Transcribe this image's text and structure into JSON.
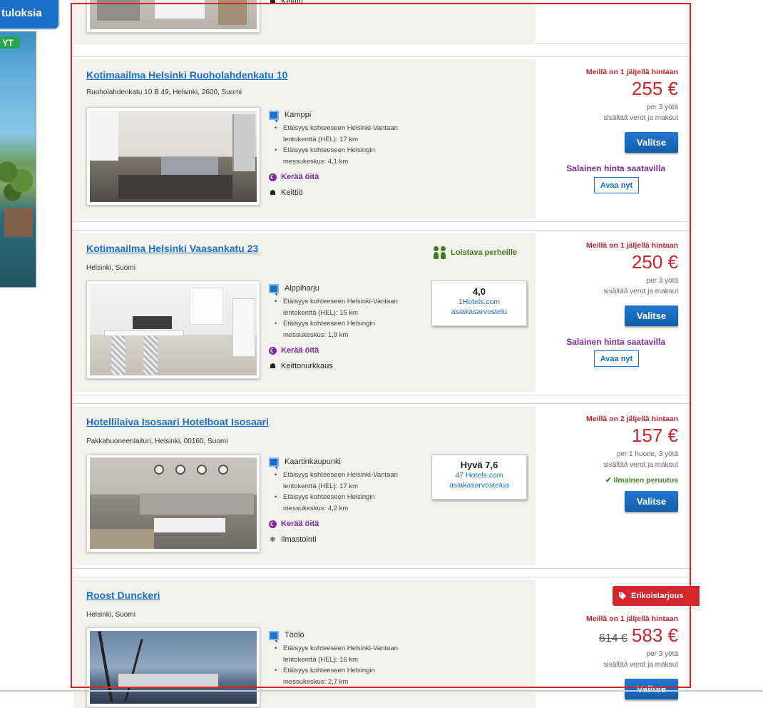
{
  "left_panel": {
    "button_label": "tuloksia",
    "badge_label": "YT"
  },
  "common": {
    "select_label": "Valitse",
    "secret_label": "Salainen hinta saatavilla",
    "open_label": "Avaa nyt",
    "collect_nights": "Kerää öitä"
  },
  "card0": {
    "collect_label": "Kerää öitä",
    "amenity": "Keittiö"
  },
  "card1": {
    "title": "Kotimaailma Helsinki Ruoholahdenkatu 10",
    "address": "Ruoholahdenkatu 10 B 49, Helsinki, 2600, Suomi",
    "area": "Kamppi",
    "dist1": "Etäisyys kohteeseen Helsinki-Vantaan lentokenttä (HEL): 17 km",
    "dist2": "Etäisyys kohteeseen Helsingin messukeskus: 4,1 km",
    "amenity": "Keittiö",
    "availability": "Meillä on 1 jäljellä hintaan",
    "price": "255 €",
    "per": "per 3 yötä",
    "taxes": "sisältää verot ja maksut"
  },
  "card2": {
    "title": "Kotimaailma Helsinki Vaasankatu 23",
    "address": "Helsinki, Suomi",
    "family": "Loistava perheille",
    "area": "Alppiharju",
    "dist1": "Etäisyys kohteeseen Helsinki-Vantaan lentokenttä (HEL): 15 km",
    "dist2": "Etäisyys kohteeseen Helsingin messukeskus: 1,9 km",
    "amenity": "Keittonurkkaus",
    "review_score": "4,0",
    "review_line1": "1Hotels.com",
    "review_line2": "asiakasarvostelu",
    "availability": "Meillä on 1 jäljellä hintaan",
    "price": "250 €",
    "per": "per 3 yötä",
    "taxes": "sisältää verot ja maksut"
  },
  "card3": {
    "title": "Hotellilaiva Isosaari Hotelboat Isosaari",
    "address": "Pakkahuoneenlaituri, Helsinki, 00160, Suomi",
    "area": "Kaartinkaupunki",
    "dist1": "Etäisyys kohteeseen Helsinki-Vantaan lentokenttä (HEL): 17 km",
    "dist2": "Etäisyys kohteeseen Helsingin messukeskus: 4,2 km",
    "amenity": "Ilmastointi",
    "review_score": "Hyvä 7,6",
    "review_line1": "47 Hotels.com",
    "review_line2": "asiakasarvostelua",
    "availability": "Meillä on 2 jäljellä hintaan",
    "price": "157 €",
    "per": "per 1 huone, 3 yötä",
    "taxes": "sisältää verot ja maksut",
    "cancel": "Ilmainen peruutus"
  },
  "card4": {
    "title": "Roost Dunckeri",
    "address": "Helsinki, Suomi",
    "area": "Töölö",
    "dist1": "Etäisyys kohteeseen Helsinki-Vantaan lentokenttä (HEL): 16 km",
    "dist2": "Etäisyys kohteeseen Helsingin messukeskus: 2,7 km",
    "offer": "Erikoistarjous",
    "availability": "Meillä on 1 jäljellä hintaan",
    "old_price": "614 €",
    "price": "583 €",
    "per": "per 3 yötä",
    "taxes": "sisältää verot ja maksut"
  },
  "colors": {
    "link": "#1a6fc9",
    "price_red": "#c4262e",
    "purple": "#7b2a9c",
    "green": "#3d8b23",
    "frame_red": "#e02424"
  }
}
